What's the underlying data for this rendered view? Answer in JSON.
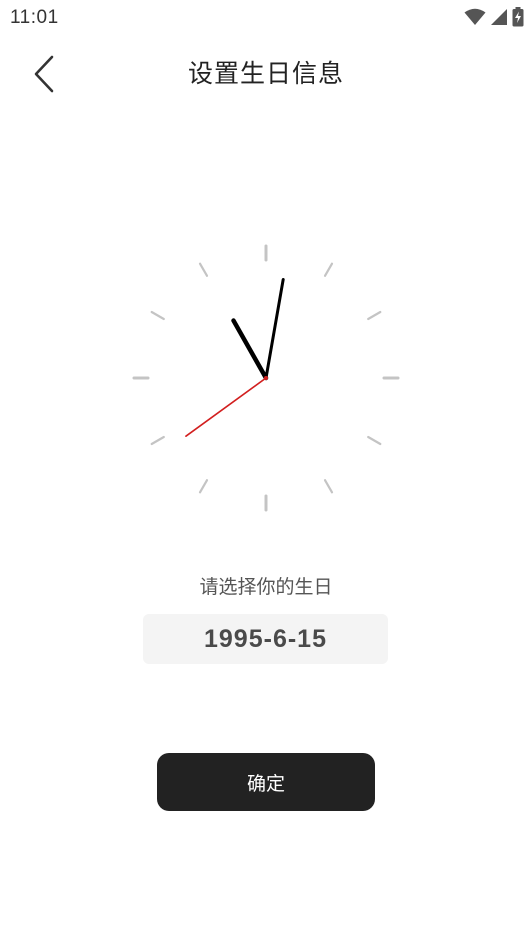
{
  "status_bar": {
    "time": "11:01",
    "icons": [
      "wifi-icon",
      "cellular-signal-icon",
      "battery-charging-icon"
    ]
  },
  "nav": {
    "back_icon": "chevron-left-icon",
    "title": "设置生日信息"
  },
  "clock": {
    "hour": 11,
    "minute": 1,
    "second": 39,
    "colors": {
      "tick": "#c4c4c4",
      "hands": "#000000",
      "second_hand": "#d21f1f"
    }
  },
  "birthday": {
    "prompt": "请选择你的生日",
    "value": "1995-6-15"
  },
  "actions": {
    "confirm_label": "确定"
  },
  "colors": {
    "button_bg": "#222222",
    "field_bg": "#f4f4f4"
  }
}
